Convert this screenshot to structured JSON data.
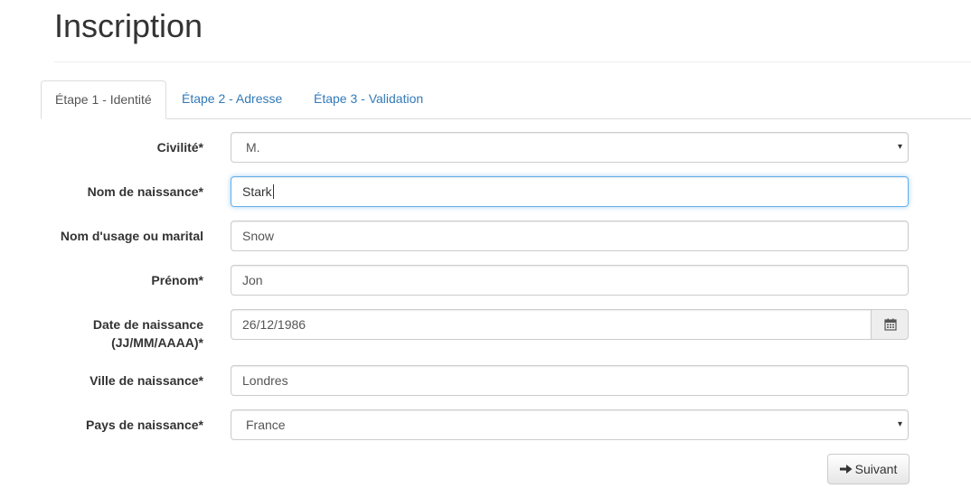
{
  "page": {
    "title": "Inscription"
  },
  "tabs": [
    {
      "label": "Étape 1 - Identité",
      "active": true
    },
    {
      "label": "Étape 2 - Adresse",
      "active": false
    },
    {
      "label": "Étape 3 - Validation",
      "active": false
    }
  ],
  "form": {
    "civilite": {
      "label": "Civilité*",
      "value": "M."
    },
    "nom_naissance": {
      "label": "Nom de naissance*",
      "value": "Stark"
    },
    "nom_usage": {
      "label": "Nom d'usage ou marital",
      "value": "Snow"
    },
    "prenom": {
      "label": "Prénom*",
      "value": "Jon"
    },
    "date_naissance": {
      "label_line1": "Date de naissance",
      "label_line2": "(JJ/MM/AAAA)*",
      "value": "26/12/1986",
      "icon": "calendar-icon"
    },
    "ville_naissance": {
      "label": "Ville de naissance*",
      "value": "Londres"
    },
    "pays_naissance": {
      "label": "Pays de naissance*",
      "value": "France"
    }
  },
  "actions": {
    "next_label": "Suivant",
    "next_icon": "arrow-right-icon"
  },
  "colors": {
    "link": "#337ab7",
    "focus": "#66afe9",
    "text": "#333333"
  }
}
